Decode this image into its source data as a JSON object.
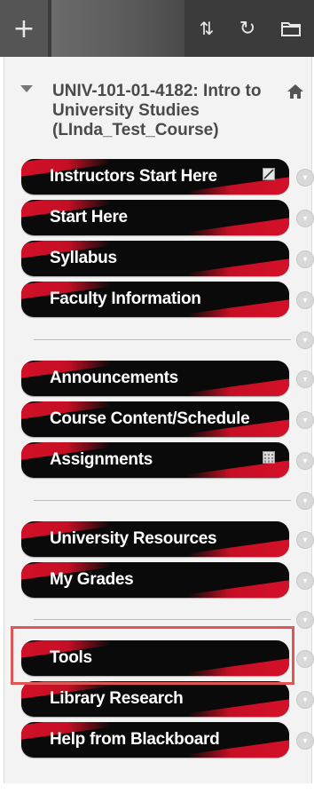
{
  "toolbar": {
    "icons": [
      "add-icon",
      "sort-icon",
      "refresh-icon",
      "folder-icon"
    ],
    "add_glyph": "+",
    "sort_glyph": "⇅",
    "refresh_glyph": "↻"
  },
  "course": {
    "title": "UNIV-101-01-4182: Intro to University Studies (LInda_Test_Course)"
  },
  "nav": {
    "items": [
      {
        "label": "Instructors Start Here"
      },
      {
        "label": "Start Here"
      },
      {
        "label": "Syllabus"
      },
      {
        "label": "Faculty Information"
      },
      {
        "label": "Announcements"
      },
      {
        "label": "Course Content/Schedule"
      },
      {
        "label": "Assignments"
      },
      {
        "label": "University Resources"
      },
      {
        "label": "My Grades"
      },
      {
        "label": "Tools"
      },
      {
        "label": "Library Research"
      },
      {
        "label": "Help from Blackboard"
      }
    ]
  },
  "colors": {
    "button_bg": "#0a0a0a",
    "button_accent": "#c50f24",
    "highlight": "#e05555",
    "toolbar": "#3b3b3b",
    "panel": "#f3f3f3"
  },
  "highlighted_item": "Tools"
}
